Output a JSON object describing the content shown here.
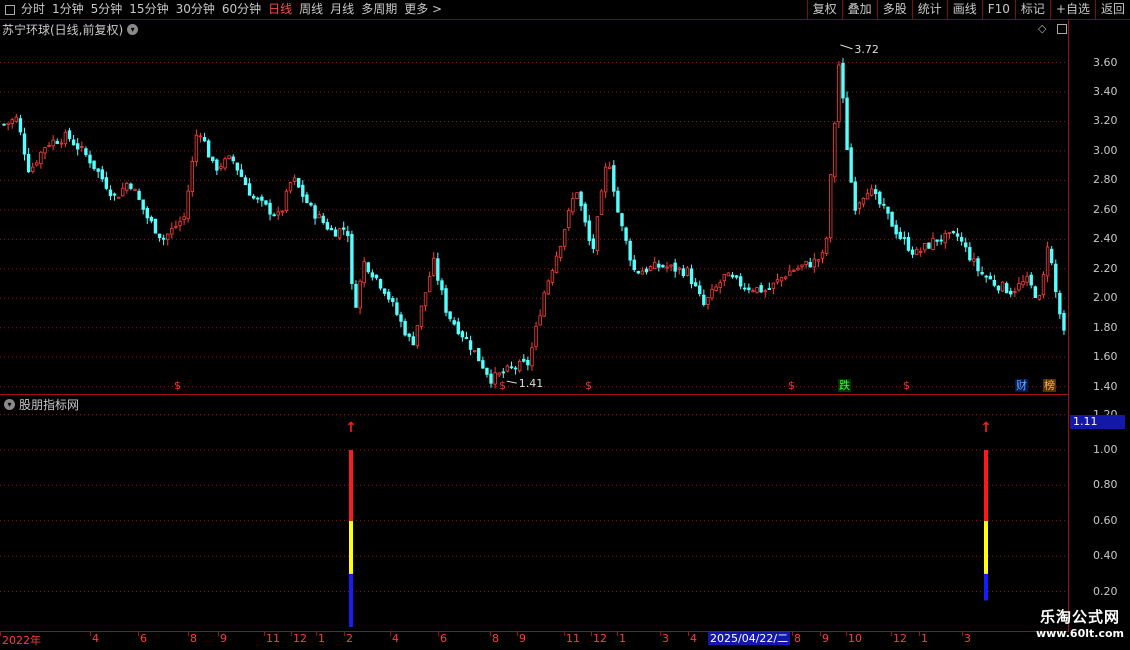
{
  "toolbar": {
    "periods": [
      "分时",
      "1分钟",
      "5分钟",
      "15分钟",
      "30分钟",
      "60分钟",
      "日线",
      "周线",
      "月线",
      "多周期",
      "更多 >"
    ],
    "active_period": "日线",
    "right_buttons": [
      "复权",
      "叠加",
      "多股",
      "统计",
      "画线",
      "F10",
      "标记",
      "+自选",
      "返回"
    ]
  },
  "main_chart": {
    "title": "苏宁环球(日线,前复权)",
    "high_label": "3.72",
    "low_label": "1.41",
    "y_ticks": [
      "3.60",
      "3.40",
      "3.20",
      "3.00",
      "2.80",
      "2.60",
      "2.40",
      "2.20",
      "2.00",
      "1.80",
      "1.60",
      "1.40"
    ],
    "badges": [
      {
        "text": "$",
        "color": "#ff3030",
        "bg": "none"
      },
      {
        "text": "$",
        "color": "#ff3030",
        "bg": "none"
      },
      {
        "text": "$",
        "color": "#ff3030",
        "bg": "none"
      },
      {
        "text": "$",
        "color": "#ff3030",
        "bg": "none"
      },
      {
        "text": "跌",
        "color": "#33ff33",
        "bg": "#003300"
      },
      {
        "text": "$",
        "color": "#ff3030",
        "bg": "none"
      },
      {
        "text": "财",
        "color": "#6fa8ff",
        "bg": "#001a55"
      },
      {
        "text": "榜",
        "color": "#ffb050",
        "bg": "#553300"
      }
    ]
  },
  "indicator": {
    "title": "股朋指标网",
    "current_value": "1.11",
    "y_ticks": [
      "1.20",
      "1.00",
      "0.80",
      "0.60",
      "0.40",
      "0.20"
    ],
    "arrow_glyph": "↑"
  },
  "x_axis": {
    "labels": [
      "2022年",
      "4",
      "6",
      "8",
      "9",
      "11",
      "12",
      "1",
      "2",
      "4",
      "6",
      "8",
      "9",
      "11",
      "12",
      "1",
      "3",
      "4",
      "8",
      "9",
      "10",
      "12",
      "1",
      "3"
    ],
    "cursor_date": "2025/04/22/二"
  },
  "watermark": {
    "line1": "乐淘公式网",
    "line2": "www.60lt.com"
  },
  "colors": {
    "up": "#ff3b3b",
    "down": "#54ffff",
    "grid": "#a01010",
    "signal_red": "#ff1a1a",
    "signal_yellow": "#ffff00",
    "signal_blue": "#1a1aff"
  },
  "chart_data": {
    "type": "candlestick",
    "title": "苏宁环球(日线,前复权)",
    "ylim": [
      1.35,
      3.78
    ],
    "price_path": [
      {
        "pos": 0.0,
        "price": 3.18
      },
      {
        "pos": 0.012,
        "price": 3.22
      },
      {
        "pos": 0.024,
        "price": 2.86
      },
      {
        "pos": 0.04,
        "price": 3.05
      },
      {
        "pos": 0.06,
        "price": 3.1
      },
      {
        "pos": 0.08,
        "price": 2.95
      },
      {
        "pos": 0.105,
        "price": 2.68
      },
      {
        "pos": 0.118,
        "price": 2.8
      },
      {
        "pos": 0.135,
        "price": 2.55
      },
      {
        "pos": 0.15,
        "price": 2.4
      },
      {
        "pos": 0.17,
        "price": 2.55
      },
      {
        "pos": 0.183,
        "price": 3.18
      },
      {
        "pos": 0.198,
        "price": 2.88
      },
      {
        "pos": 0.215,
        "price": 2.95
      },
      {
        "pos": 0.235,
        "price": 2.68
      },
      {
        "pos": 0.26,
        "price": 2.55
      },
      {
        "pos": 0.272,
        "price": 2.82
      },
      {
        "pos": 0.29,
        "price": 2.6
      },
      {
        "pos": 0.31,
        "price": 2.45
      },
      {
        "pos": 0.324,
        "price": 2.48
      },
      {
        "pos": 0.33,
        "price": 1.9
      },
      {
        "pos": 0.34,
        "price": 2.25
      },
      {
        "pos": 0.36,
        "price": 2.05
      },
      {
        "pos": 0.385,
        "price": 1.68
      },
      {
        "pos": 0.405,
        "price": 2.25
      },
      {
        "pos": 0.418,
        "price": 1.9
      },
      {
        "pos": 0.44,
        "price": 1.68
      },
      {
        "pos": 0.46,
        "price": 1.45
      },
      {
        "pos": 0.478,
        "price": 1.52
      },
      {
        "pos": 0.495,
        "price": 1.56
      },
      {
        "pos": 0.51,
        "price": 2.05
      },
      {
        "pos": 0.525,
        "price": 2.38
      },
      {
        "pos": 0.54,
        "price": 2.75
      },
      {
        "pos": 0.555,
        "price": 2.3
      },
      {
        "pos": 0.57,
        "price": 2.98
      },
      {
        "pos": 0.58,
        "price": 2.55
      },
      {
        "pos": 0.595,
        "price": 2.18
      },
      {
        "pos": 0.62,
        "price": 2.22
      },
      {
        "pos": 0.645,
        "price": 2.18
      },
      {
        "pos": 0.66,
        "price": 1.95
      },
      {
        "pos": 0.68,
        "price": 2.15
      },
      {
        "pos": 0.7,
        "price": 2.08
      },
      {
        "pos": 0.72,
        "price": 2.05
      },
      {
        "pos": 0.74,
        "price": 2.18
      },
      {
        "pos": 0.765,
        "price": 2.25
      },
      {
        "pos": 0.775,
        "price": 2.3
      },
      {
        "pos": 0.78,
        "price": 2.82
      },
      {
        "pos": 0.788,
        "price": 3.62
      },
      {
        "pos": 0.795,
        "price": 3.05
      },
      {
        "pos": 0.802,
        "price": 2.62
      },
      {
        "pos": 0.815,
        "price": 2.75
      },
      {
        "pos": 0.83,
        "price": 2.6
      },
      {
        "pos": 0.845,
        "price": 2.42
      },
      {
        "pos": 0.86,
        "price": 2.3
      },
      {
        "pos": 0.88,
        "price": 2.4
      },
      {
        "pos": 0.9,
        "price": 2.42
      },
      {
        "pos": 0.92,
        "price": 2.18
      },
      {
        "pos": 0.935,
        "price": 2.1
      },
      {
        "pos": 0.95,
        "price": 2.05
      },
      {
        "pos": 0.965,
        "price": 2.12
      },
      {
        "pos": 0.978,
        "price": 1.98
      },
      {
        "pos": 0.985,
        "price": 2.4
      },
      {
        "pos": 0.992,
        "price": 2.05
      },
      {
        "pos": 1.0,
        "price": 1.75
      }
    ],
    "high": {
      "value": 3.72
    },
    "low": {
      "value": 1.41
    },
    "indicator_signals": [
      {
        "bottom": 0.0,
        "top": 1.0,
        "segments": [
          {
            "from": 0.0,
            "to": 0.3,
            "color": "blue"
          },
          {
            "from": 0.3,
            "to": 0.6,
            "color": "yellow"
          },
          {
            "from": 0.6,
            "to": 1.0,
            "color": "red"
          }
        ]
      },
      {
        "bottom": 0.15,
        "top": 1.0,
        "segments": [
          {
            "from": 0.15,
            "to": 0.3,
            "color": "blue"
          },
          {
            "from": 0.3,
            "to": 0.6,
            "color": "yellow"
          },
          {
            "from": 0.6,
            "to": 1.0,
            "color": "red"
          }
        ]
      }
    ],
    "indicator_ylim": [
      0.0,
      1.22
    ]
  }
}
